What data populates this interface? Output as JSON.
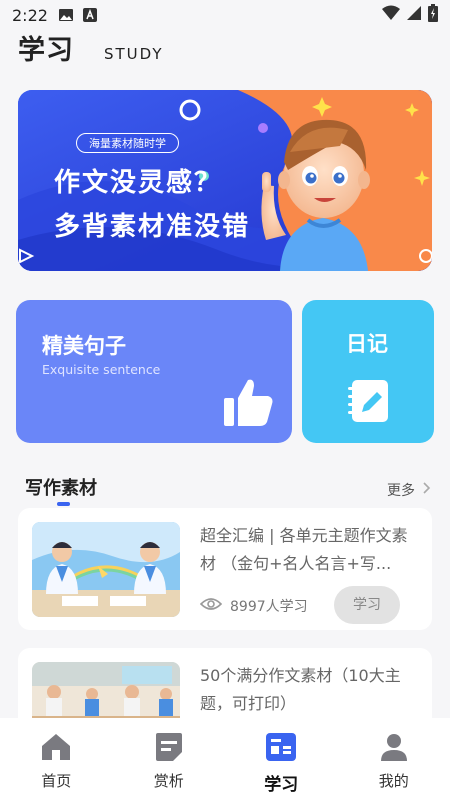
{
  "status_bar": {
    "time": "2:22"
  },
  "header": {
    "title": "学习",
    "subtitle": "STUDY"
  },
  "banner": {
    "tag": "海量素材随时学",
    "line1": "作文没灵感？",
    "line2": "多背素材准没错"
  },
  "cards": {
    "sentences": {
      "title": "精美句子",
      "subtitle": "Exquisite sentence",
      "icon": "thumbs-up-icon"
    },
    "diary": {
      "title": "日记",
      "icon": "notebook-pencil-icon"
    }
  },
  "section": {
    "title": "写作素材",
    "more": "更多"
  },
  "articles": [
    {
      "title": "超全汇编 | 各单元主题作文素材 （金句+名人名言+写...",
      "views": "8997人学习",
      "button": "学习"
    },
    {
      "title": "50个满分作文素材（10大主题，可打印）"
    }
  ],
  "tabbar": [
    {
      "label": "首页",
      "icon": "home-icon"
    },
    {
      "label": "赏析",
      "icon": "document-icon"
    },
    {
      "label": "学习",
      "icon": "study-icon",
      "active": true
    },
    {
      "label": "我的",
      "icon": "profile-icon"
    }
  ],
  "colors": {
    "accent": "#3a64f0",
    "card_blue": "#6a86f8",
    "card_cyan": "#44c7f4",
    "banner_orange": "#f9894a"
  }
}
